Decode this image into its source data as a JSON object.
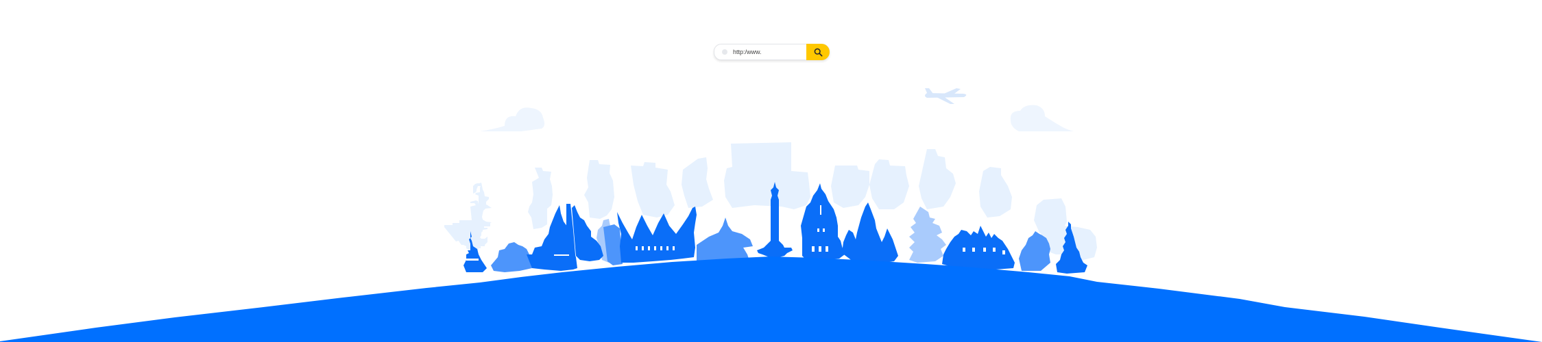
{
  "search": {
    "url_text": "http:/www.",
    "button_icon": "search-icon",
    "button_color": "#ffc800"
  },
  "colors": {
    "ground": "#0070ff",
    "landmark_dark": "#0a6ef8",
    "landmark_mid": "#4d95fb",
    "landmark_light": "#a9cbfc",
    "building_bg": "#e6f1fe",
    "cloud": "#eef5fe",
    "airplane": "#d8e7fb"
  }
}
